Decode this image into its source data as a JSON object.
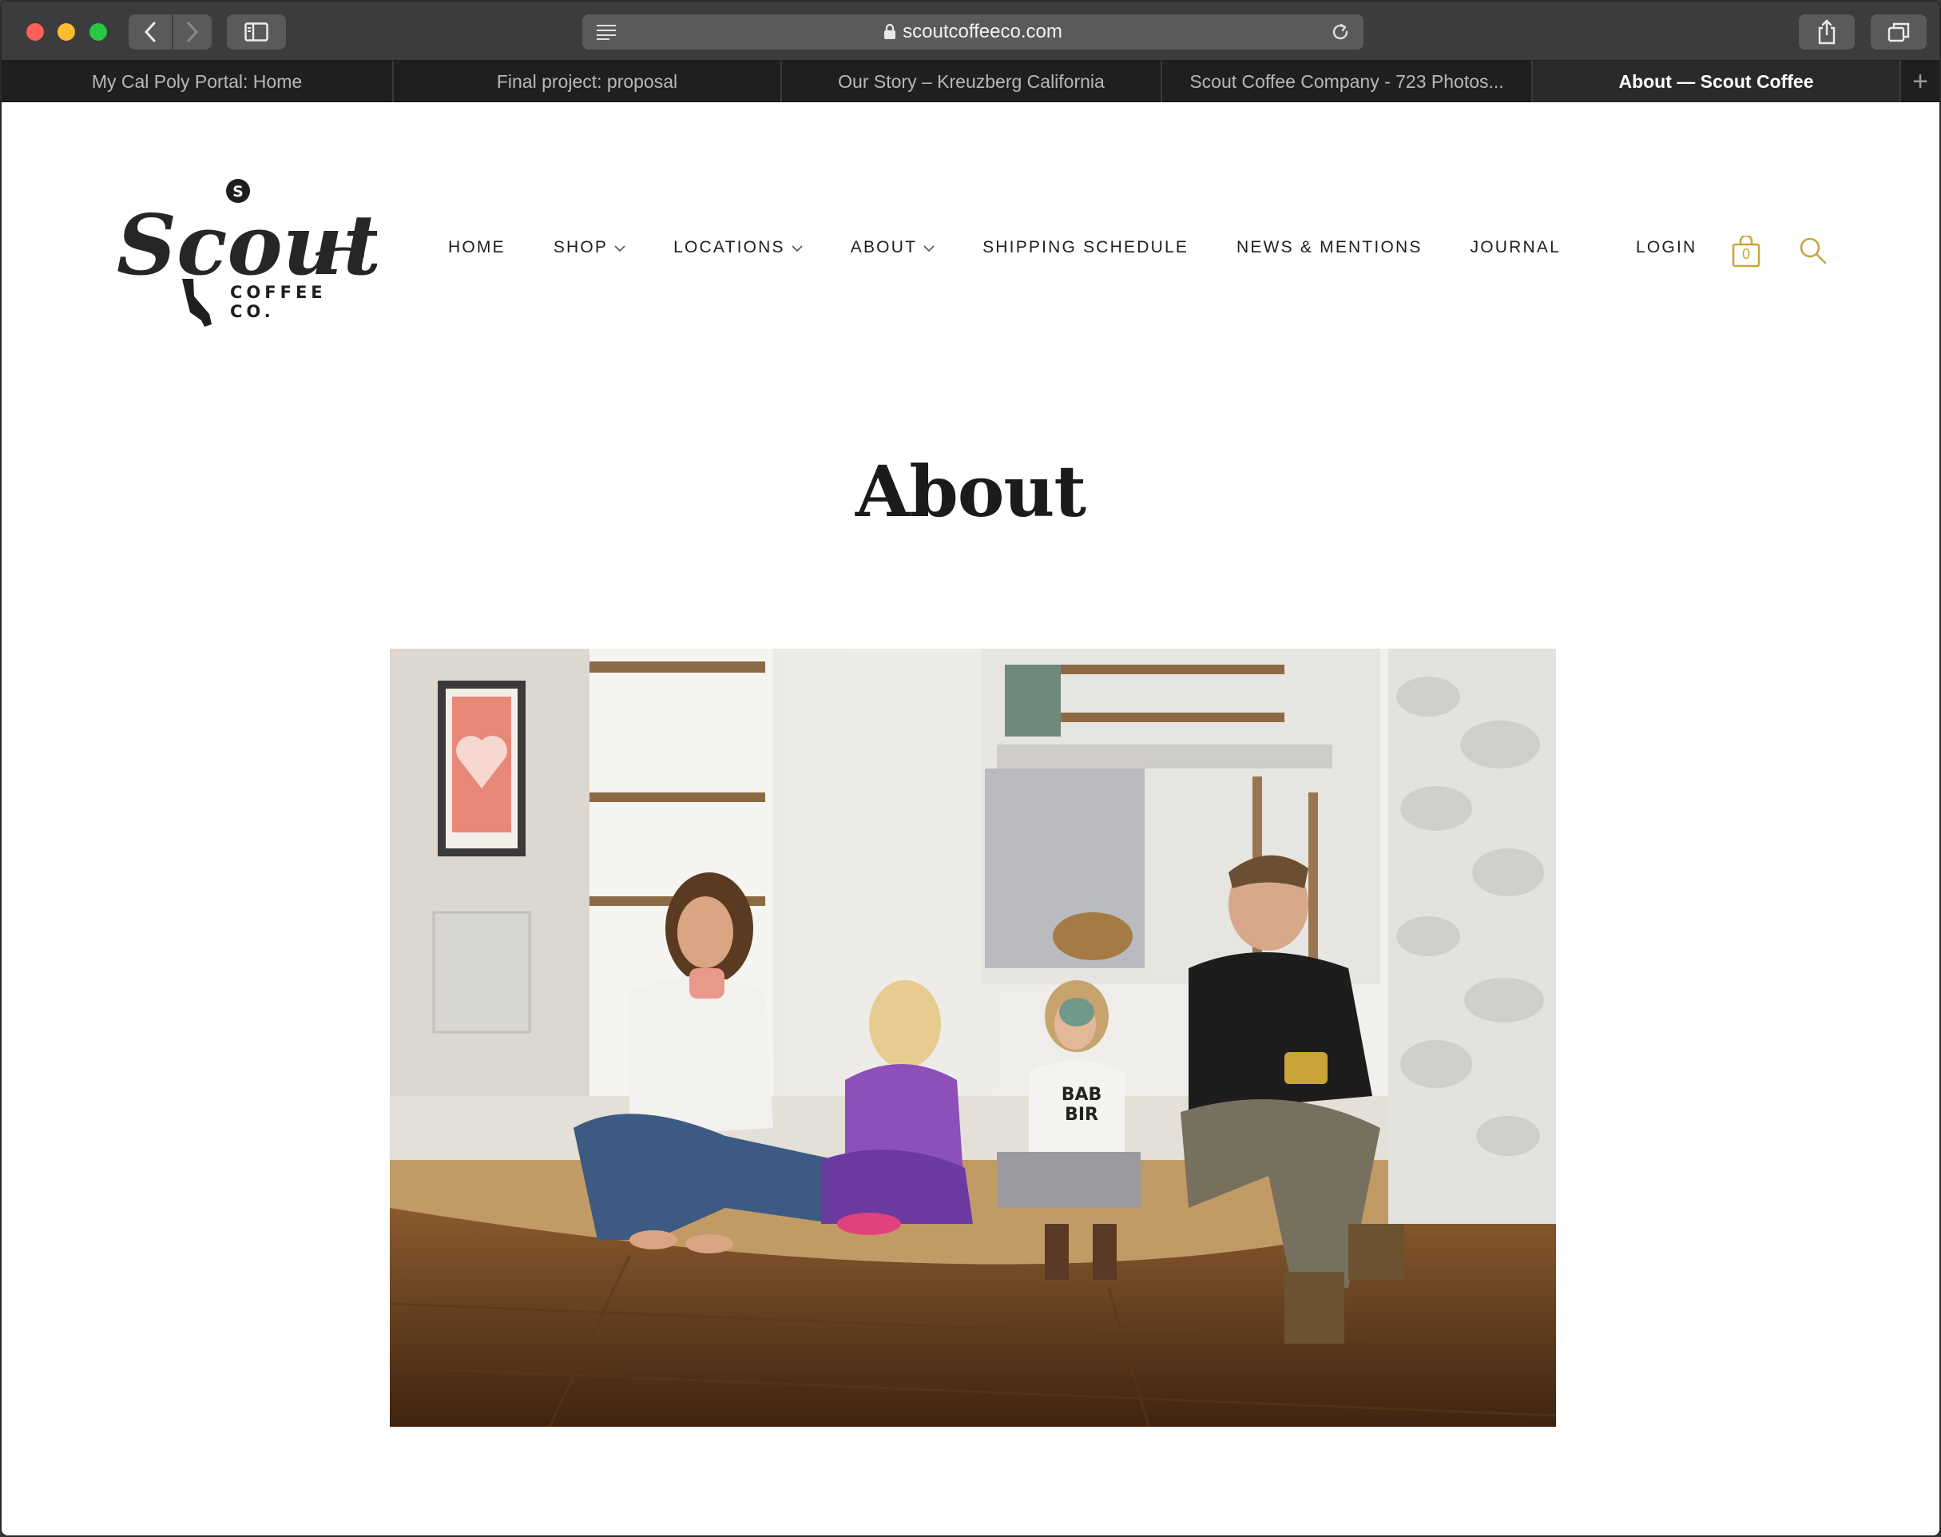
{
  "browser": {
    "url": "scoutcoffeeco.com",
    "tabs": [
      {
        "label": "My Cal Poly Portal: Home",
        "active": false
      },
      {
        "label": "Final project: proposal",
        "active": false
      },
      {
        "label": "Our Story – Kreuzberg California",
        "active": false
      },
      {
        "label": "Scout Coffee Company - 723 Photos...",
        "active": false
      },
      {
        "label": "About — Scout Coffee",
        "active": true
      }
    ],
    "new_tab": "+"
  },
  "site": {
    "logo": {
      "script": "Scout",
      "badge": "S",
      "line1": "COFFEE",
      "line2": "CO."
    },
    "nav": [
      {
        "label": "HOME",
        "dropdown": false
      },
      {
        "label": "SHOP",
        "dropdown": true
      },
      {
        "label": "LOCATIONS",
        "dropdown": true
      },
      {
        "label": "ABOUT",
        "dropdown": true
      },
      {
        "label": "SHIPPING SCHEDULE",
        "dropdown": false
      },
      {
        "label": "NEWS & MENTIONS",
        "dropdown": false
      },
      {
        "label": "JOURNAL",
        "dropdown": false
      }
    ],
    "login": "LOGIN",
    "cart_count": "0",
    "accent_color": "#c9a539"
  },
  "main": {
    "title": "About",
    "hero_image": "family-drinking-coffee-photo",
    "hero_shirt_text": [
      "BAB",
      "BIR"
    ]
  }
}
